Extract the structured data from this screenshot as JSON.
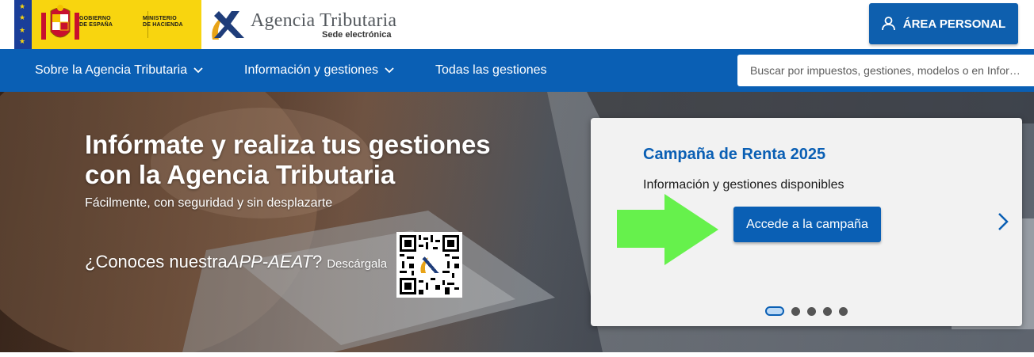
{
  "header": {
    "government": {
      "line1": "GOBIERNO",
      "line2": "DE ESPAÑA",
      "ministry_line1": "MINISTERIO",
      "ministry_line2": "DE HACIENDA"
    },
    "brand": {
      "name": "Agencia Tributaria",
      "subtitle": "Sede electrónica"
    },
    "personal_area": {
      "label": "ÁREA PERSONAL",
      "icon": "user-icon"
    }
  },
  "nav": {
    "items": [
      {
        "label": "Sobre la Agencia Tributaria",
        "has_dropdown": true
      },
      {
        "label": "Información y gestiones",
        "has_dropdown": true
      },
      {
        "label": "Todas las gestiones",
        "has_dropdown": false
      }
    ],
    "search": {
      "placeholder": "Buscar por impuestos, gestiones, modelos o en Infor…",
      "value": ""
    }
  },
  "hero": {
    "title": "Infórmate y realiza tus gestiones con la Agencia Tributaria",
    "subtitle": "Fácilmente, con seguridad y sin desplazarte",
    "app_prefix": "¿Conoces nuestra ",
    "app_name": "APP-AEAT",
    "app_suffix": "?",
    "download": "Descárgala"
  },
  "carousel": {
    "title": "Campaña de Renta 2025",
    "description": "Información y gestiones disponibles",
    "button": "Accede a la campaña",
    "slide_count": 5,
    "active_slide": 1
  },
  "colors": {
    "brand_blue": "#0a5fb4",
    "gov_yellow": "#f8d50f",
    "highlight_arrow": "#5ef042"
  }
}
